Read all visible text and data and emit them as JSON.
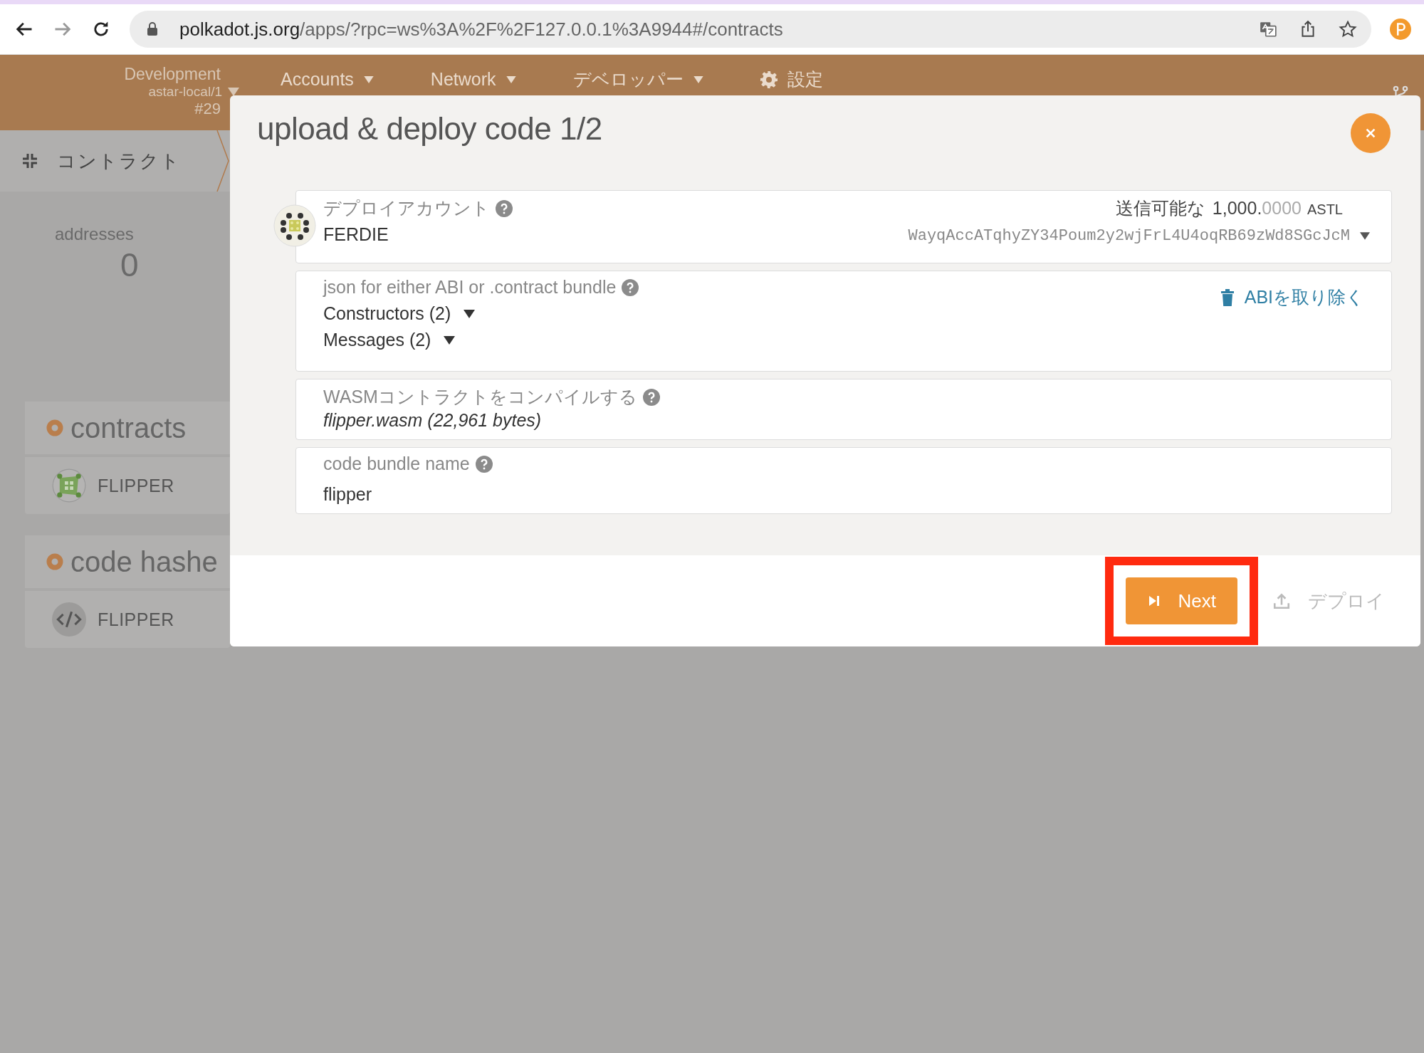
{
  "browser": {
    "url_host": "polkadot.js.org",
    "url_path": "/apps/?rpc=ws%3A%2F%2F127.0.0.1%3A9944#/contracts"
  },
  "header": {
    "chain": "Development",
    "node": "astar-local/1",
    "block": "#29",
    "nav": [
      {
        "label": "Accounts",
        "kind": "dropdown"
      },
      {
        "label": "Network",
        "kind": "dropdown"
      },
      {
        "label": "デベロッパー",
        "kind": "dropdown"
      },
      {
        "label": "設定",
        "kind": "settings"
      }
    ]
  },
  "sidebar": {
    "tab": "コントラクト"
  },
  "summary": {
    "label": "addresses",
    "value": "0"
  },
  "sections": [
    {
      "title": "contracts",
      "items": [
        {
          "name": "FLIPPER",
          "kind": "contract"
        }
      ]
    },
    {
      "title": "code hashe",
      "items": [
        {
          "name": "FLIPPER",
          "kind": "code"
        }
      ]
    }
  ],
  "modal": {
    "title": "upload & deploy code 1/2",
    "account": {
      "label": "デプロイアカウント",
      "name": "FERDIE",
      "balance_label": "送信可能な",
      "balance_whole": "1,000.",
      "balance_fraction": "0000",
      "unit": "ASTL",
      "address": "WayqAccATqhyZY34Poum2y2wjFrL4U4oqRB69zWd8SGcJcM"
    },
    "abi": {
      "label": "json for either ABI or .contract bundle",
      "remove": "ABIを取り除く",
      "groups": [
        {
          "label": "Constructors (2)",
          "expanded": false
        },
        {
          "label": "Messages (2)",
          "expanded": false
        }
      ]
    },
    "wasm": {
      "label": "WASMコントラクトをコンパイルする",
      "file": "flipper.wasm (22,961 bytes)"
    },
    "bundle": {
      "label": "code bundle name",
      "value": "flipper"
    },
    "buttons": [
      {
        "label": "Next",
        "kind": "next",
        "disabled": false,
        "highlighted": true
      },
      {
        "label": "デプロイ",
        "kind": "deploy",
        "disabled": true,
        "highlighted": false
      }
    ]
  }
}
